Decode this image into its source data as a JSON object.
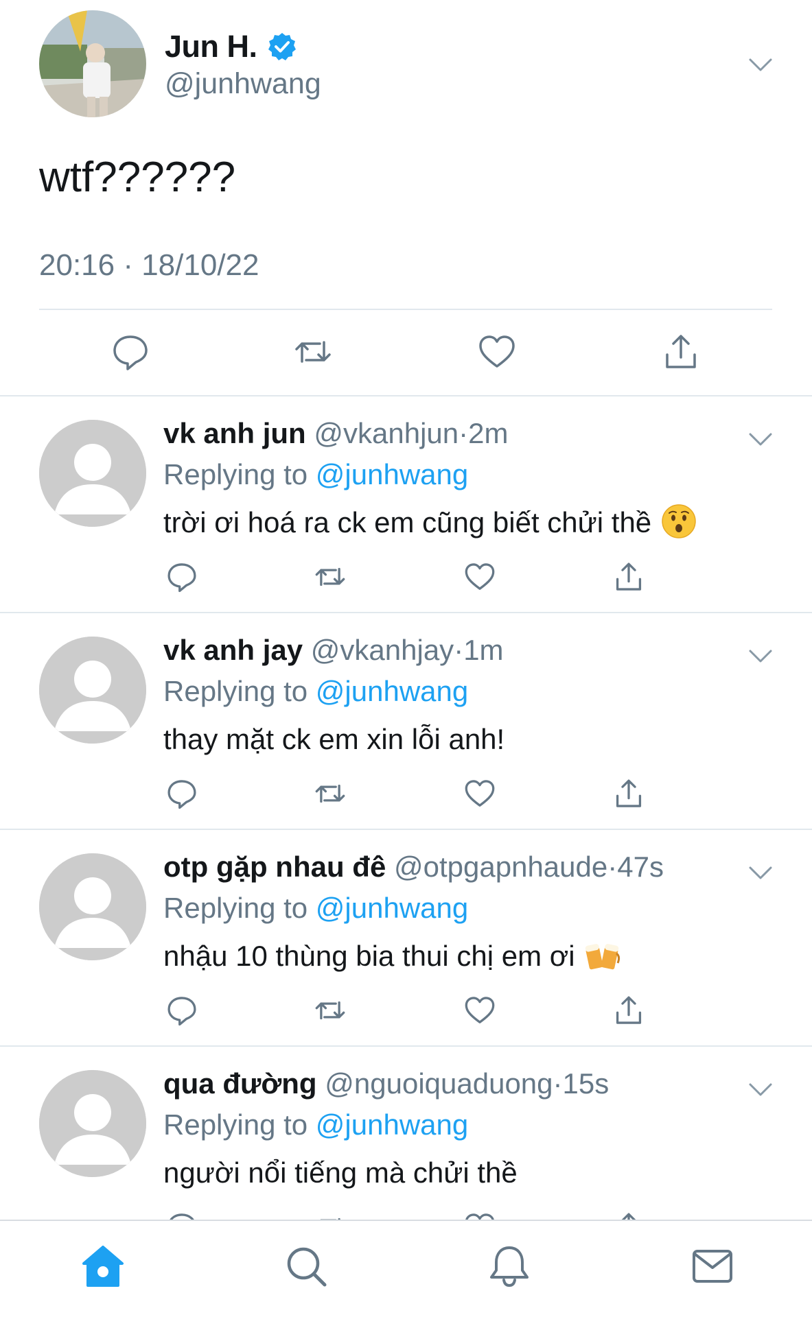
{
  "main_tweet": {
    "author_name": "Jun H.",
    "author_handle": "@junhwang",
    "verified": true,
    "text": "wtf??????",
    "timestamp": "20:16 · 18/10/22",
    "icons": [
      "reply-icon",
      "retweet-icon",
      "like-icon",
      "share-icon",
      "chevron-down-icon",
      "verified-badge-icon"
    ]
  },
  "replies": [
    {
      "name": "vk anh jun",
      "handle": "@vkanhjun",
      "dot": "·",
      "time": "2m",
      "replying_label": "Replying to",
      "replying_to": "@junhwang",
      "text": "trời ơi hoá ra ck em cũng biết chửi thề",
      "emoji": "hushed-face-emoji"
    },
    {
      "name": "vk anh jay",
      "handle": "@vkanhjay",
      "dot": "·",
      "time": "1m",
      "replying_label": "Replying to",
      "replying_to": "@junhwang",
      "text": "thay mặt ck em xin lỗi anh!"
    },
    {
      "name": "otp gặp nhau đê",
      "handle": "@otpgapnhaude",
      "dot": "·",
      "time": "47s",
      "replying_label": "Replying to",
      "replying_to": "@junhwang",
      "text": "nhậu 10 thùng bia thui chị em ơi",
      "emoji": "beer-mugs-emoji"
    },
    {
      "name": "qua đường",
      "handle": "@nguoiquaduong",
      "dot": "·",
      "time": "15s",
      "replying_label": "Replying to",
      "replying_to": "@junhwang",
      "text": "người nổi tiếng mà chửi thề"
    }
  ],
  "tabbar": {
    "tabs": [
      "home-icon",
      "search-icon",
      "notifications-icon",
      "messages-icon"
    ],
    "active": "home-icon"
  },
  "colors": {
    "accent": "#1da1f2",
    "secondary_text": "#657786",
    "divider": "#e1e8ed",
    "avatar_placeholder": "#cccccc"
  }
}
